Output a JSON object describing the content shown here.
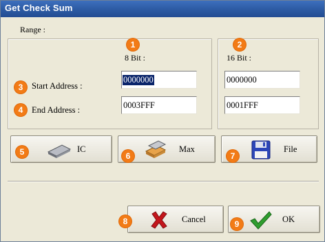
{
  "window": {
    "title": "Get Check Sum"
  },
  "range": {
    "label": "Range :",
    "col_8bit": "8 Bit :",
    "col_16bit": "16 Bit :",
    "start_label": "Start Address :",
    "end_label": "End Address :",
    "start_8bit": "0000000",
    "end_8bit": "0003FFF",
    "start_16bit": "0000000",
    "end_16bit": "0001FFF"
  },
  "buttons": {
    "ic": "IC",
    "max": "Max",
    "file": "File",
    "cancel": "Cancel",
    "ok": "OK"
  },
  "badges": [
    "1",
    "2",
    "3",
    "4",
    "5",
    "6",
    "7",
    "8",
    "9"
  ],
  "colors": {
    "titlebar": "#2c5aa3",
    "badge": "#f27b16",
    "selection": "#0a246a",
    "cancel_x": "#c4161c",
    "ok_check": "#2f9e2f"
  }
}
